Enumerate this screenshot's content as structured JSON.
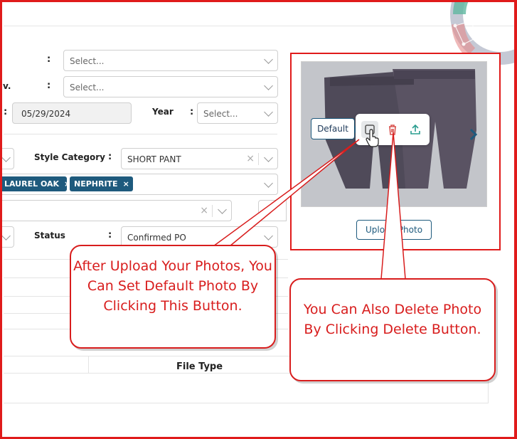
{
  "form": {
    "row1": {
      "colon": ":",
      "placeholder": "Select..."
    },
    "row2": {
      "label": "v.",
      "colon": ":",
      "placeholder": "Select..."
    },
    "row3": {
      "colon": ":",
      "date_value": "05/29/2024",
      "year_label": "Year",
      "year_colon": ":",
      "year_placeholder": "Select..."
    },
    "style_category": {
      "label": "Style Category",
      "colon": ":",
      "value": "SHORT PANT",
      "clear": "×"
    },
    "colors": {
      "tags": [
        {
          "label": "LAUREL OAK",
          "remove": "×"
        },
        {
          "label": "NEPHRITE",
          "remove": "×"
        }
      ]
    },
    "row6": {
      "clear": "×"
    },
    "status": {
      "label": "Status",
      "colon": ":",
      "value": "Confirmed PO"
    }
  },
  "table": {
    "file_type_header": "File Type"
  },
  "photo": {
    "default_label": "Default",
    "upload_label": "Upload Photo"
  },
  "callouts": {
    "default_text": "After Upload Your Photos, You Can Set Default Photo By Clicking This Button.",
    "delete_text": "You Can Also Delete Photo By Clicking Delete Button."
  },
  "colors": {
    "accent": "#1e5a7d",
    "annotation_red": "#d81d1d",
    "delete_red": "#d9534f",
    "upload_green": "#2a9d8f"
  }
}
